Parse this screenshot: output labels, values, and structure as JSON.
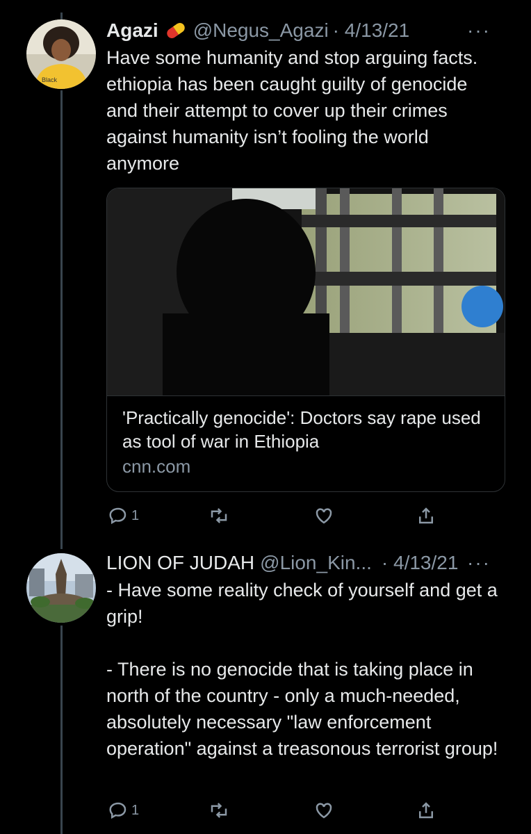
{
  "tweets": [
    {
      "name": "Agazi",
      "badge_icon": "pill-icon",
      "handle": "@Negus_Agazi",
      "date": "· 4/13/21",
      "text": "Have some humanity and stop arguing facts.  ethiopia has been caught guilty of genocide and their attempt to cover up their crimes against humanity isn’t fooling the world anymore",
      "card": {
        "title": "'Practically genocide': Doctors say rape used as tool of war in Ethiopia",
        "domain": "cnn.com"
      },
      "reply_count": "1",
      "more": "···"
    },
    {
      "name": "LION OF JUDAH",
      "handle": "@Lion_Kin...",
      "date": "· 4/13/21",
      "text": "- Have some reality check of yourself and get a grip!\n\n- There is no genocide that is taking place in north of the country - only a much-needed, absolutely necessary \"law enforcement operation\" against a treasonous terrorist group!",
      "reply_count": "1",
      "more": "···"
    }
  ],
  "colors": {
    "background": "#000000",
    "text": "#e7e9ea",
    "muted": "#8b98a5",
    "border": "#2f3336"
  }
}
